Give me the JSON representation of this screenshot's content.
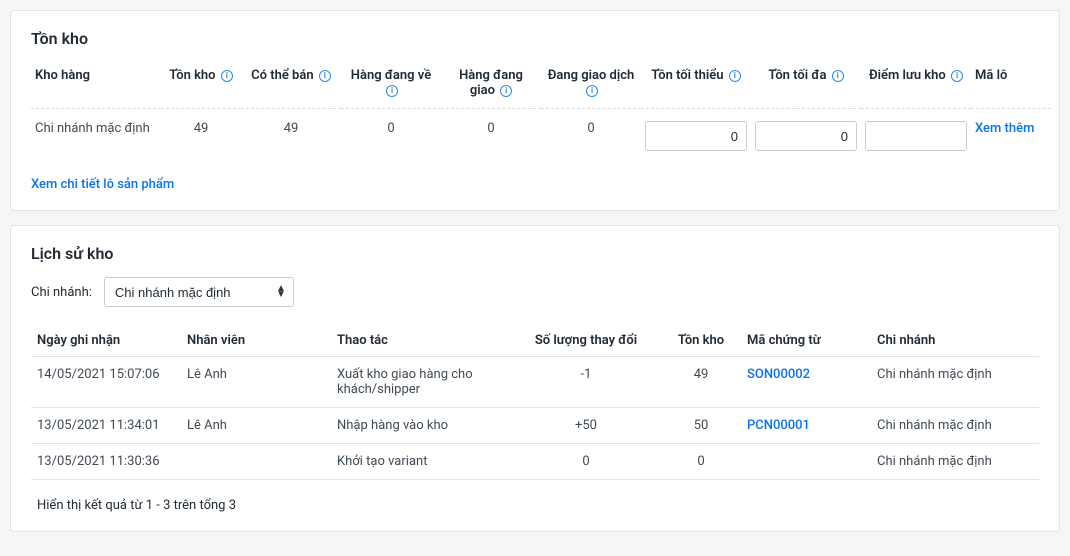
{
  "inventory": {
    "title": "Tồn kho",
    "headers": {
      "warehouse": "Kho hàng",
      "stock": "Tồn kho",
      "available": "Có thể bán",
      "incoming": "Hàng đang về",
      "outgoing": "Hàng đang giao",
      "trading": "Đang giao dịch",
      "min": "Tồn tối thiểu",
      "max": "Tồn tối đa",
      "storage_point": "Điểm lưu kho",
      "lot": "Mã lô"
    },
    "row": {
      "warehouse": "Chi nhánh mặc định",
      "stock": "49",
      "available": "49",
      "incoming": "0",
      "outgoing": "0",
      "trading": "0",
      "min": "0",
      "max": "0",
      "storage_point": "",
      "lot_action": "Xem thêm"
    },
    "detail_link": "Xem chi tiết lô sản phẩm"
  },
  "history": {
    "title": "Lịch sử kho",
    "filter_label": "Chi nhánh:",
    "filter_value": "Chi nhánh mặc định",
    "headers": {
      "date": "Ngày ghi nhận",
      "employee": "Nhân viên",
      "action": "Thao tác",
      "qty_change": "Số lượng thay đổi",
      "stock": "Tồn kho",
      "doc_code": "Mã chứng từ",
      "branch": "Chi nhánh"
    },
    "rows": [
      {
        "date": "14/05/2021 15:07:06",
        "employee": "Lê Anh",
        "action": "Xuất kho giao hàng cho khách/shipper",
        "qty_change": "-1",
        "stock": "49",
        "doc_code": "SON00002",
        "branch": "Chi nhánh mặc định"
      },
      {
        "date": "13/05/2021 11:34:01",
        "employee": "Lê Anh",
        "action": "Nhập hàng vào kho",
        "qty_change": "+50",
        "stock": "50",
        "doc_code": "PCN00001",
        "branch": "Chi nhánh mặc định"
      },
      {
        "date": "13/05/2021 11:30:36",
        "employee": "",
        "action": "Khởi tạo variant",
        "qty_change": "0",
        "stock": "0",
        "doc_code": "",
        "branch": "Chi nhánh mặc định"
      }
    ],
    "result_text": "Hiển thị kết quả từ 1 - 3 trên tổng 3"
  }
}
